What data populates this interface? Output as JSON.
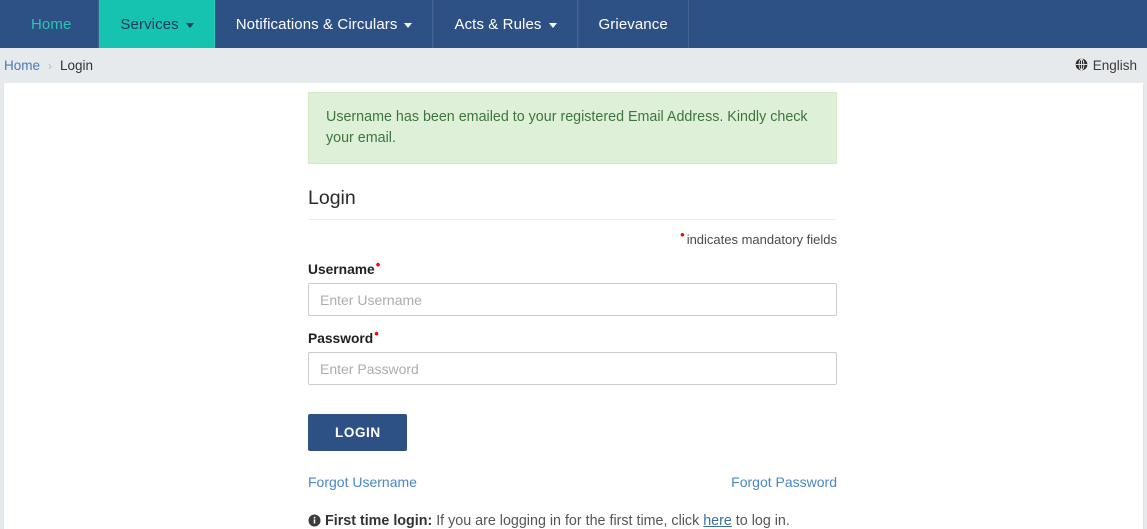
{
  "navbar": {
    "items": [
      {
        "label": "Home",
        "has_caret": false,
        "state": "home"
      },
      {
        "label": "Services",
        "has_caret": true,
        "state": "active"
      },
      {
        "label": "Notifications & Circulars",
        "has_caret": true,
        "state": "normal"
      },
      {
        "label": "Acts & Rules",
        "has_caret": true,
        "state": "normal"
      },
      {
        "label": "Grievance",
        "has_caret": false,
        "state": "normal"
      }
    ],
    "active_color": "#16c2b0",
    "background_color": "#2e5185",
    "home_link_color": "#2ac4b0"
  },
  "breadcrumb": {
    "home_label": "Home",
    "separator": "›",
    "current_label": "Login"
  },
  "language": {
    "icon": "globe-icon",
    "label": "English"
  },
  "alert": {
    "type": "success",
    "message": "Username has been emailed to your registered Email Address. Kindly check your email.",
    "background_color": "#dff0d8",
    "text_color": "#3c763d"
  },
  "form": {
    "title": "Login",
    "mandatory_note": "indicates mandatory fields",
    "mandatory_marker": "•",
    "fields": [
      {
        "label": "Username",
        "required_marker": "•",
        "value": "",
        "placeholder": "Enter Username",
        "type": "text"
      },
      {
        "label": "Password",
        "required_marker": "•",
        "value": "",
        "placeholder": "Enter Password",
        "type": "password"
      }
    ],
    "submit_label": "LOGIN",
    "submit_color": "#2e5185",
    "forgot_username_label": "Forgot Username",
    "forgot_password_label": "Forgot Password"
  },
  "first_time": {
    "icon": "info-circle-icon",
    "bold_label": "First time login:",
    "text_before": " If you are logging in for the first time, click ",
    "link_label": "here",
    "text_after": " to log in."
  }
}
